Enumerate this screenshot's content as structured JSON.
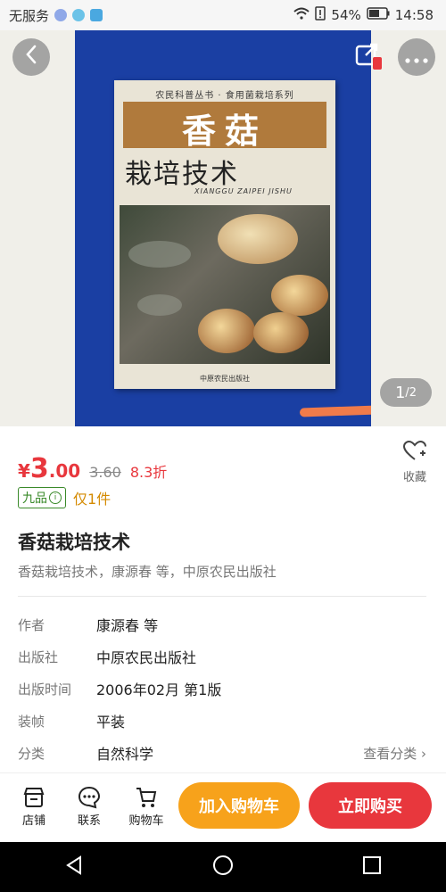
{
  "status_bar": {
    "carrier": "无服务",
    "battery": "54%",
    "time": "14:58"
  },
  "cover": {
    "series": "农民科普丛书 · 食用菌栽培系列",
    "title_main": "香菇",
    "title_sub": "栽培技术",
    "pinyin": "XIANGGU ZAIPEI JISHU",
    "publisher": "中原农民出版社"
  },
  "gallery": {
    "current": "1",
    "total": "/2"
  },
  "price": {
    "symbol": "¥",
    "integer": "3",
    "decimal": ".00",
    "original": "3.60",
    "discount": "8.3折"
  },
  "favorite_label": "收藏",
  "condition": {
    "label": "九品",
    "stock": "仅1件"
  },
  "product": {
    "title": "香菇栽培技术",
    "subtitle": "香菇栽培技术，康源春 等，中原农民出版社"
  },
  "specs": [
    {
      "key": "作者",
      "value": "康源春 等"
    },
    {
      "key": "出版社",
      "value": "中原农民出版社"
    },
    {
      "key": "出版时间",
      "value": "2006年02月 第1版"
    },
    {
      "key": "装帧",
      "value": "平装"
    },
    {
      "key": "分类",
      "value": "自然科学",
      "link": "查看分类 ›"
    }
  ],
  "bottom_bar": {
    "shop": "店铺",
    "contact": "联系",
    "cart": "购物车",
    "add_to_cart": "加入购物车",
    "buy_now": "立即购买"
  },
  "colors": {
    "accent_red": "#e8373d",
    "accent_orange": "#f7a21b",
    "condition_green": "#3a8a2a"
  }
}
